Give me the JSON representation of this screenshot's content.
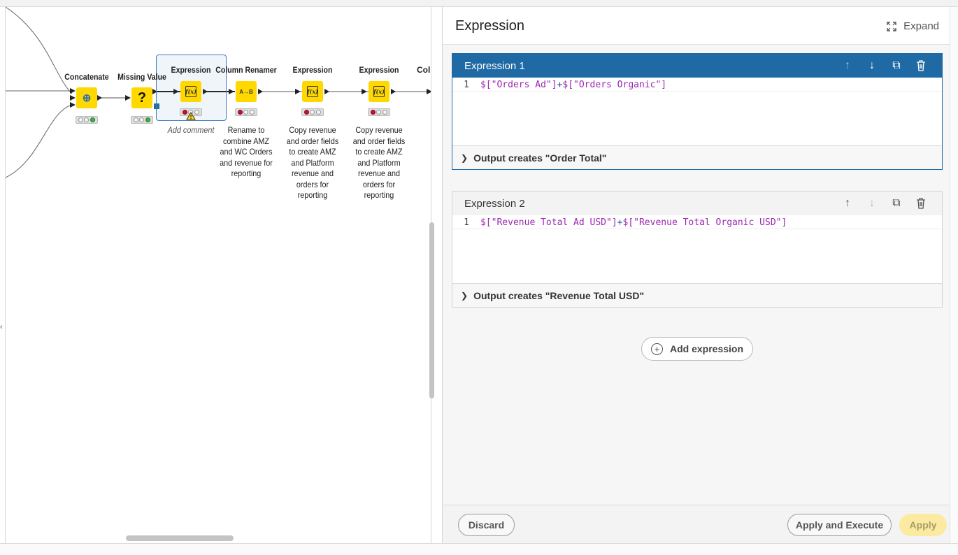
{
  "workflow": {
    "nodes": [
      {
        "id": "concatenate",
        "title": "Concatenate",
        "glyph": "⊕",
        "comment": ""
      },
      {
        "id": "missing-value",
        "title": "Missing Value",
        "glyph": "?",
        "comment": ""
      },
      {
        "id": "expression-selected",
        "title": "Expression",
        "glyph": "f(x)",
        "comment": "Add comment"
      },
      {
        "id": "column-renamer",
        "title": "Column Renamer",
        "glyph": "A→B",
        "comment": "Rename to combine AMZ and WC Orders and revenue for reporting"
      },
      {
        "id": "expression-2",
        "title": "Expression",
        "glyph": "f(x)",
        "comment": "Copy revenue and order fields to create AMZ and Platform revenue and orders for reporting"
      },
      {
        "id": "expression-3",
        "title": "Expression",
        "glyph": "f(x)",
        "comment": "Copy revenue and order fields to create AMZ and Platform revenue and orders for reporting"
      },
      {
        "id": "cut-node",
        "title": "Colu",
        "glyph": "",
        "comment": ""
      }
    ],
    "warning_icon": "warning-triangle-icon"
  },
  "panel": {
    "title": "Expression",
    "expand_label": "Expand",
    "expressions": [
      {
        "label": "Expression 1",
        "line_number": "1",
        "code_parts": [
          "$[\"Orders Ad\"]",
          "+",
          "$[\"Orders Organic\"]"
        ],
        "output": "Output creates \"Order Total\"",
        "can_move_up": false,
        "can_move_down": true
      },
      {
        "label": "Expression 2",
        "line_number": "1",
        "code_parts": [
          "$[\"Revenue Total Ad USD\"]",
          "+",
          "$[\"Revenue Total Organic USD\"]"
        ],
        "output": "Output creates \"Revenue Total USD\"",
        "can_move_up": true,
        "can_move_down": false
      }
    ],
    "add_expression_label": "Add expression",
    "footer": {
      "discard": "Discard",
      "apply_and_execute": "Apply and Execute",
      "apply": "Apply"
    }
  },
  "colors": {
    "node_yellow": "#ffd800",
    "active_blue": "#1f6aa5",
    "code_string": "#9c27b0",
    "apply_disabled": "#fbeaa0"
  }
}
